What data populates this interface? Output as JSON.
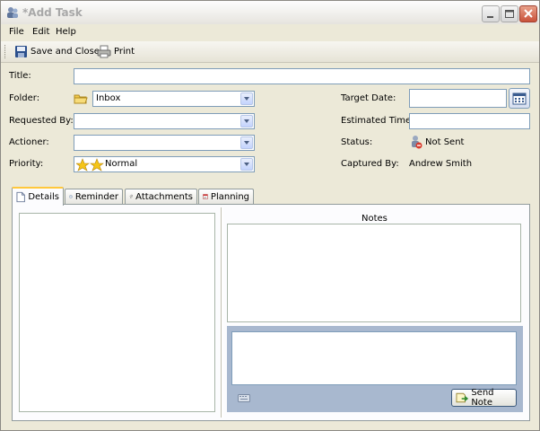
{
  "window": {
    "title": "*Add Task"
  },
  "menu": {
    "file": "File",
    "edit": "Edit",
    "help": "Help"
  },
  "toolbar": {
    "save_close": "Save and Close",
    "print": "Print"
  },
  "form": {
    "title_label": "Title:",
    "folder_label": "Folder:",
    "folder_value": "Inbox",
    "requested_by_label": "Requested By:",
    "actioner_label": "Actioner:",
    "priority_label": "Priority:",
    "priority_value": "Normal",
    "target_date_label": "Target Date:",
    "estimated_time_label": "Estimated Time:",
    "status_label": "Status:",
    "status_value": "Not Sent",
    "captured_by_label": "Captured By:",
    "captured_by_value": "Andrew Smith"
  },
  "tabs": [
    {
      "label": "Details"
    },
    {
      "label": "Reminder"
    },
    {
      "label": "Attachments"
    },
    {
      "label": "Planning"
    }
  ],
  "notes": {
    "header": "Notes",
    "send_label": "Send Note"
  },
  "colors": {
    "input_border": "#7f9db9",
    "tab_highlight": "#ffc83c",
    "note_footer": "#a8b8cf"
  }
}
